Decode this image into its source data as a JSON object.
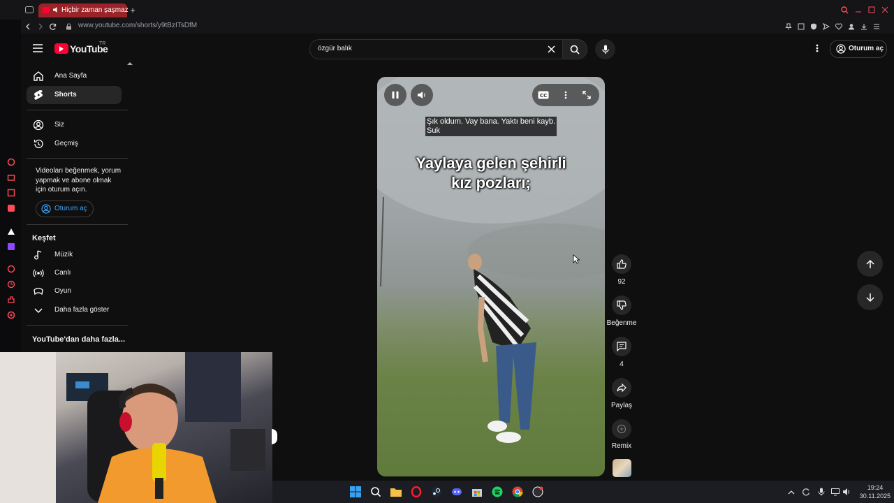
{
  "browser": {
    "tab_title": "Hiçbir zaman şaşmaz",
    "url": "www.youtube.com/shorts/y9tBzITsDfM"
  },
  "youtube": {
    "logo_text": "YouTube",
    "logo_sup": "TR",
    "search_value": "özgür balık",
    "signin_label": "Oturum aç",
    "sidebar": {
      "items": [
        {
          "label": "Ana Sayfa",
          "icon": "home-icon"
        },
        {
          "label": "Shorts",
          "icon": "shorts-icon",
          "active": true
        },
        {
          "label": "Siz",
          "icon": "user-icon"
        },
        {
          "label": "Geçmiş",
          "icon": "history-icon"
        }
      ],
      "signin_prompt": "Videoları beğenmek, yorum yapmak ve abone olmak için oturum açın.",
      "signin_button": "Oturum aç",
      "explore_title": "Keşfet",
      "explore_items": [
        {
          "label": "Müzik",
          "icon": "music-icon"
        },
        {
          "label": "Canlı",
          "icon": "live-icon"
        },
        {
          "label": "Oyun",
          "icon": "gaming-icon"
        },
        {
          "label": "Daha fazla göster",
          "icon": "chevron-down-icon"
        }
      ],
      "more_title": "YouTube'dan daha fazla..."
    },
    "short": {
      "caption_line1": "Şık oldum. Vay bana. Yaktı beni kayb.",
      "caption_line2": "Suk",
      "overlay_line1": "Yaylaya gelen şehirli",
      "overlay_line2": "kız pozları;"
    },
    "actions": {
      "like_count": "92",
      "dislike_label": "Beğenme",
      "comment_count": "4",
      "share_label": "Paylaş",
      "remix_label": "Remix"
    }
  },
  "taskbar": {
    "time": "19:24",
    "date": "30.11.2025"
  },
  "colors": {
    "yt_red": "#ff0033",
    "background": "#0f0f0f",
    "signin_blue": "#3ea6ff"
  }
}
